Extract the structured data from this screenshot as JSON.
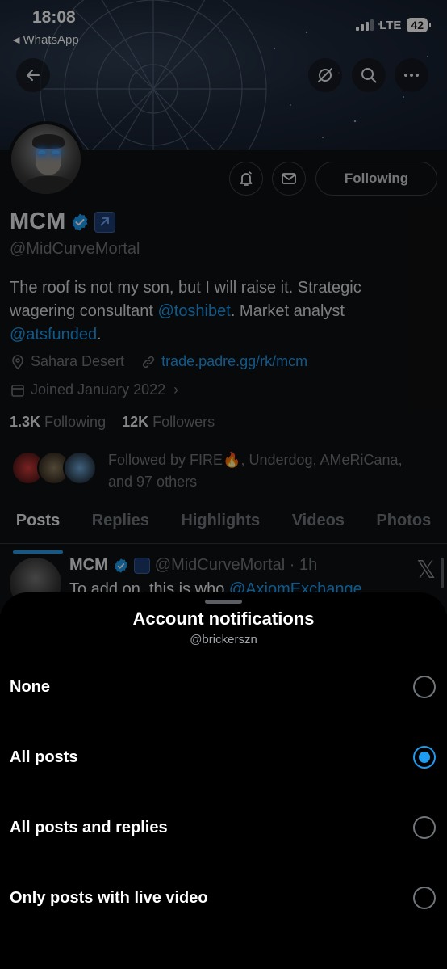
{
  "status": {
    "time": "18:08",
    "back_app": "WhatsApp",
    "network": "LTE",
    "battery": "42"
  },
  "header_icons": [
    "back-arrow-icon",
    "hide-icon",
    "search-icon",
    "more-icon"
  ],
  "profile": {
    "name": "MCM",
    "handle": "@MidCurveMortal",
    "bio_text_1": "The roof is not my son, but I will raise it. Strategic wagering consultant ",
    "bio_link_1": "@toshibet",
    "bio_text_2": ". Market analyst ",
    "bio_link_2": "@atsfunded",
    "bio_text_3": ".",
    "location": "Sahara Desert",
    "website": "trade.padre.gg/rk/mcm",
    "joined": "Joined January 2022",
    "following_count": "1.3K",
    "following_label": "Following",
    "followers_count": "12K",
    "followers_label": "Followers",
    "followed_by": "Followed by FIRE🔥, Underdog, AMeRiCana, and 97 others",
    "following_button": "Following"
  },
  "tabs": [
    {
      "label": "Posts",
      "active": true
    },
    {
      "label": "Replies",
      "active": false
    },
    {
      "label": "Highlights",
      "active": false
    },
    {
      "label": "Videos",
      "active": false
    },
    {
      "label": "Photos",
      "active": false
    }
  ],
  "post": {
    "name": "MCM",
    "handle_time": "@MidCurveMortal · 1h",
    "text_start": "To add on, this is who ",
    "text_link": "@AxiomExchange"
  },
  "sheet": {
    "title": "Account notifications",
    "subtitle": "@brickerszn",
    "options": [
      {
        "label": "None",
        "selected": false
      },
      {
        "label": "All posts",
        "selected": true
      },
      {
        "label": "All posts and replies",
        "selected": false
      },
      {
        "label": "Only posts with live video",
        "selected": false
      }
    ]
  },
  "colors": {
    "accent": "#1d9bf0",
    "background": "#000000",
    "muted": "#71767b"
  }
}
